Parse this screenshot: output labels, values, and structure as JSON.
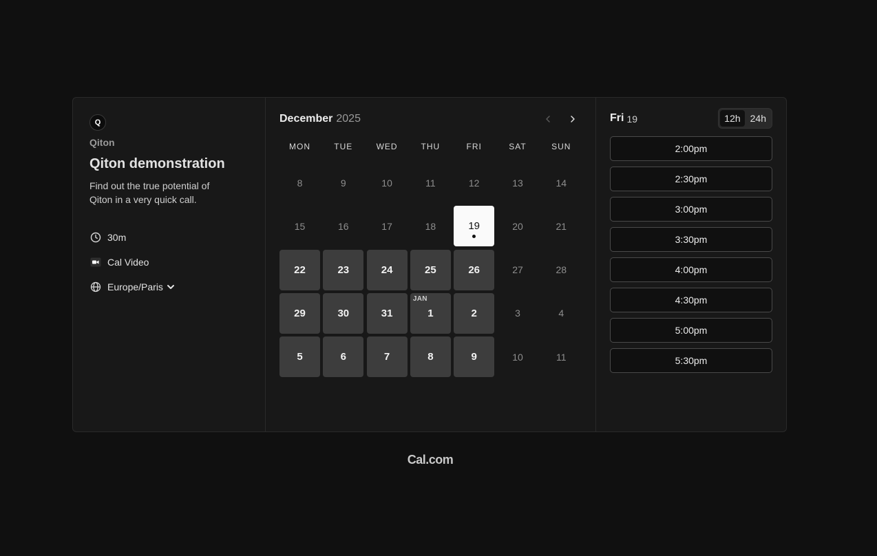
{
  "profile": {
    "avatar_letter": "Q",
    "org_name": "Qiton",
    "event_title": "Qiton demonstration",
    "event_description": "Find out the true potential of Qiton in a very quick call.",
    "duration": "30m",
    "location": "Cal Video",
    "timezone": "Europe/Paris"
  },
  "calendar": {
    "month": "December",
    "year": "2025",
    "weekdays": [
      "MON",
      "TUE",
      "WED",
      "THU",
      "FRI",
      "SAT",
      "SUN"
    ],
    "days": [
      {
        "label": "8",
        "state": "disabled"
      },
      {
        "label": "9",
        "state": "disabled"
      },
      {
        "label": "10",
        "state": "disabled"
      },
      {
        "label": "11",
        "state": "disabled"
      },
      {
        "label": "12",
        "state": "disabled"
      },
      {
        "label": "13",
        "state": "disabled"
      },
      {
        "label": "14",
        "state": "disabled"
      },
      {
        "label": "15",
        "state": "disabled"
      },
      {
        "label": "16",
        "state": "disabled"
      },
      {
        "label": "17",
        "state": "disabled"
      },
      {
        "label": "18",
        "state": "disabled"
      },
      {
        "label": "19",
        "state": "selected"
      },
      {
        "label": "20",
        "state": "disabled"
      },
      {
        "label": "21",
        "state": "disabled"
      },
      {
        "label": "22",
        "state": "available"
      },
      {
        "label": "23",
        "state": "available"
      },
      {
        "label": "24",
        "state": "available"
      },
      {
        "label": "25",
        "state": "available"
      },
      {
        "label": "26",
        "state": "available"
      },
      {
        "label": "27",
        "state": "disabled"
      },
      {
        "label": "28",
        "state": "disabled"
      },
      {
        "label": "29",
        "state": "available"
      },
      {
        "label": "30",
        "state": "available"
      },
      {
        "label": "31",
        "state": "available"
      },
      {
        "label": "1",
        "state": "available",
        "tag": "JAN"
      },
      {
        "label": "2",
        "state": "available"
      },
      {
        "label": "3",
        "state": "disabled"
      },
      {
        "label": "4",
        "state": "disabled"
      },
      {
        "label": "5",
        "state": "available"
      },
      {
        "label": "6",
        "state": "available"
      },
      {
        "label": "7",
        "state": "available"
      },
      {
        "label": "8",
        "state": "available"
      },
      {
        "label": "9",
        "state": "available"
      },
      {
        "label": "10",
        "state": "disabled"
      },
      {
        "label": "11",
        "state": "disabled"
      }
    ]
  },
  "slots": {
    "day_name": "Fri",
    "day_number": "19",
    "format_options": [
      "12h",
      "24h"
    ],
    "active_format": "12h",
    "times": [
      "2:00pm",
      "2:30pm",
      "3:00pm",
      "3:30pm",
      "4:00pm",
      "4:30pm",
      "5:00pm",
      "5:30pm"
    ]
  },
  "footer": {
    "brand": "Cal.com"
  },
  "colors": {
    "background": "#101010",
    "panel": "#181818",
    "available_day": "#3d3d3d",
    "selected_day": "#fafafa"
  }
}
